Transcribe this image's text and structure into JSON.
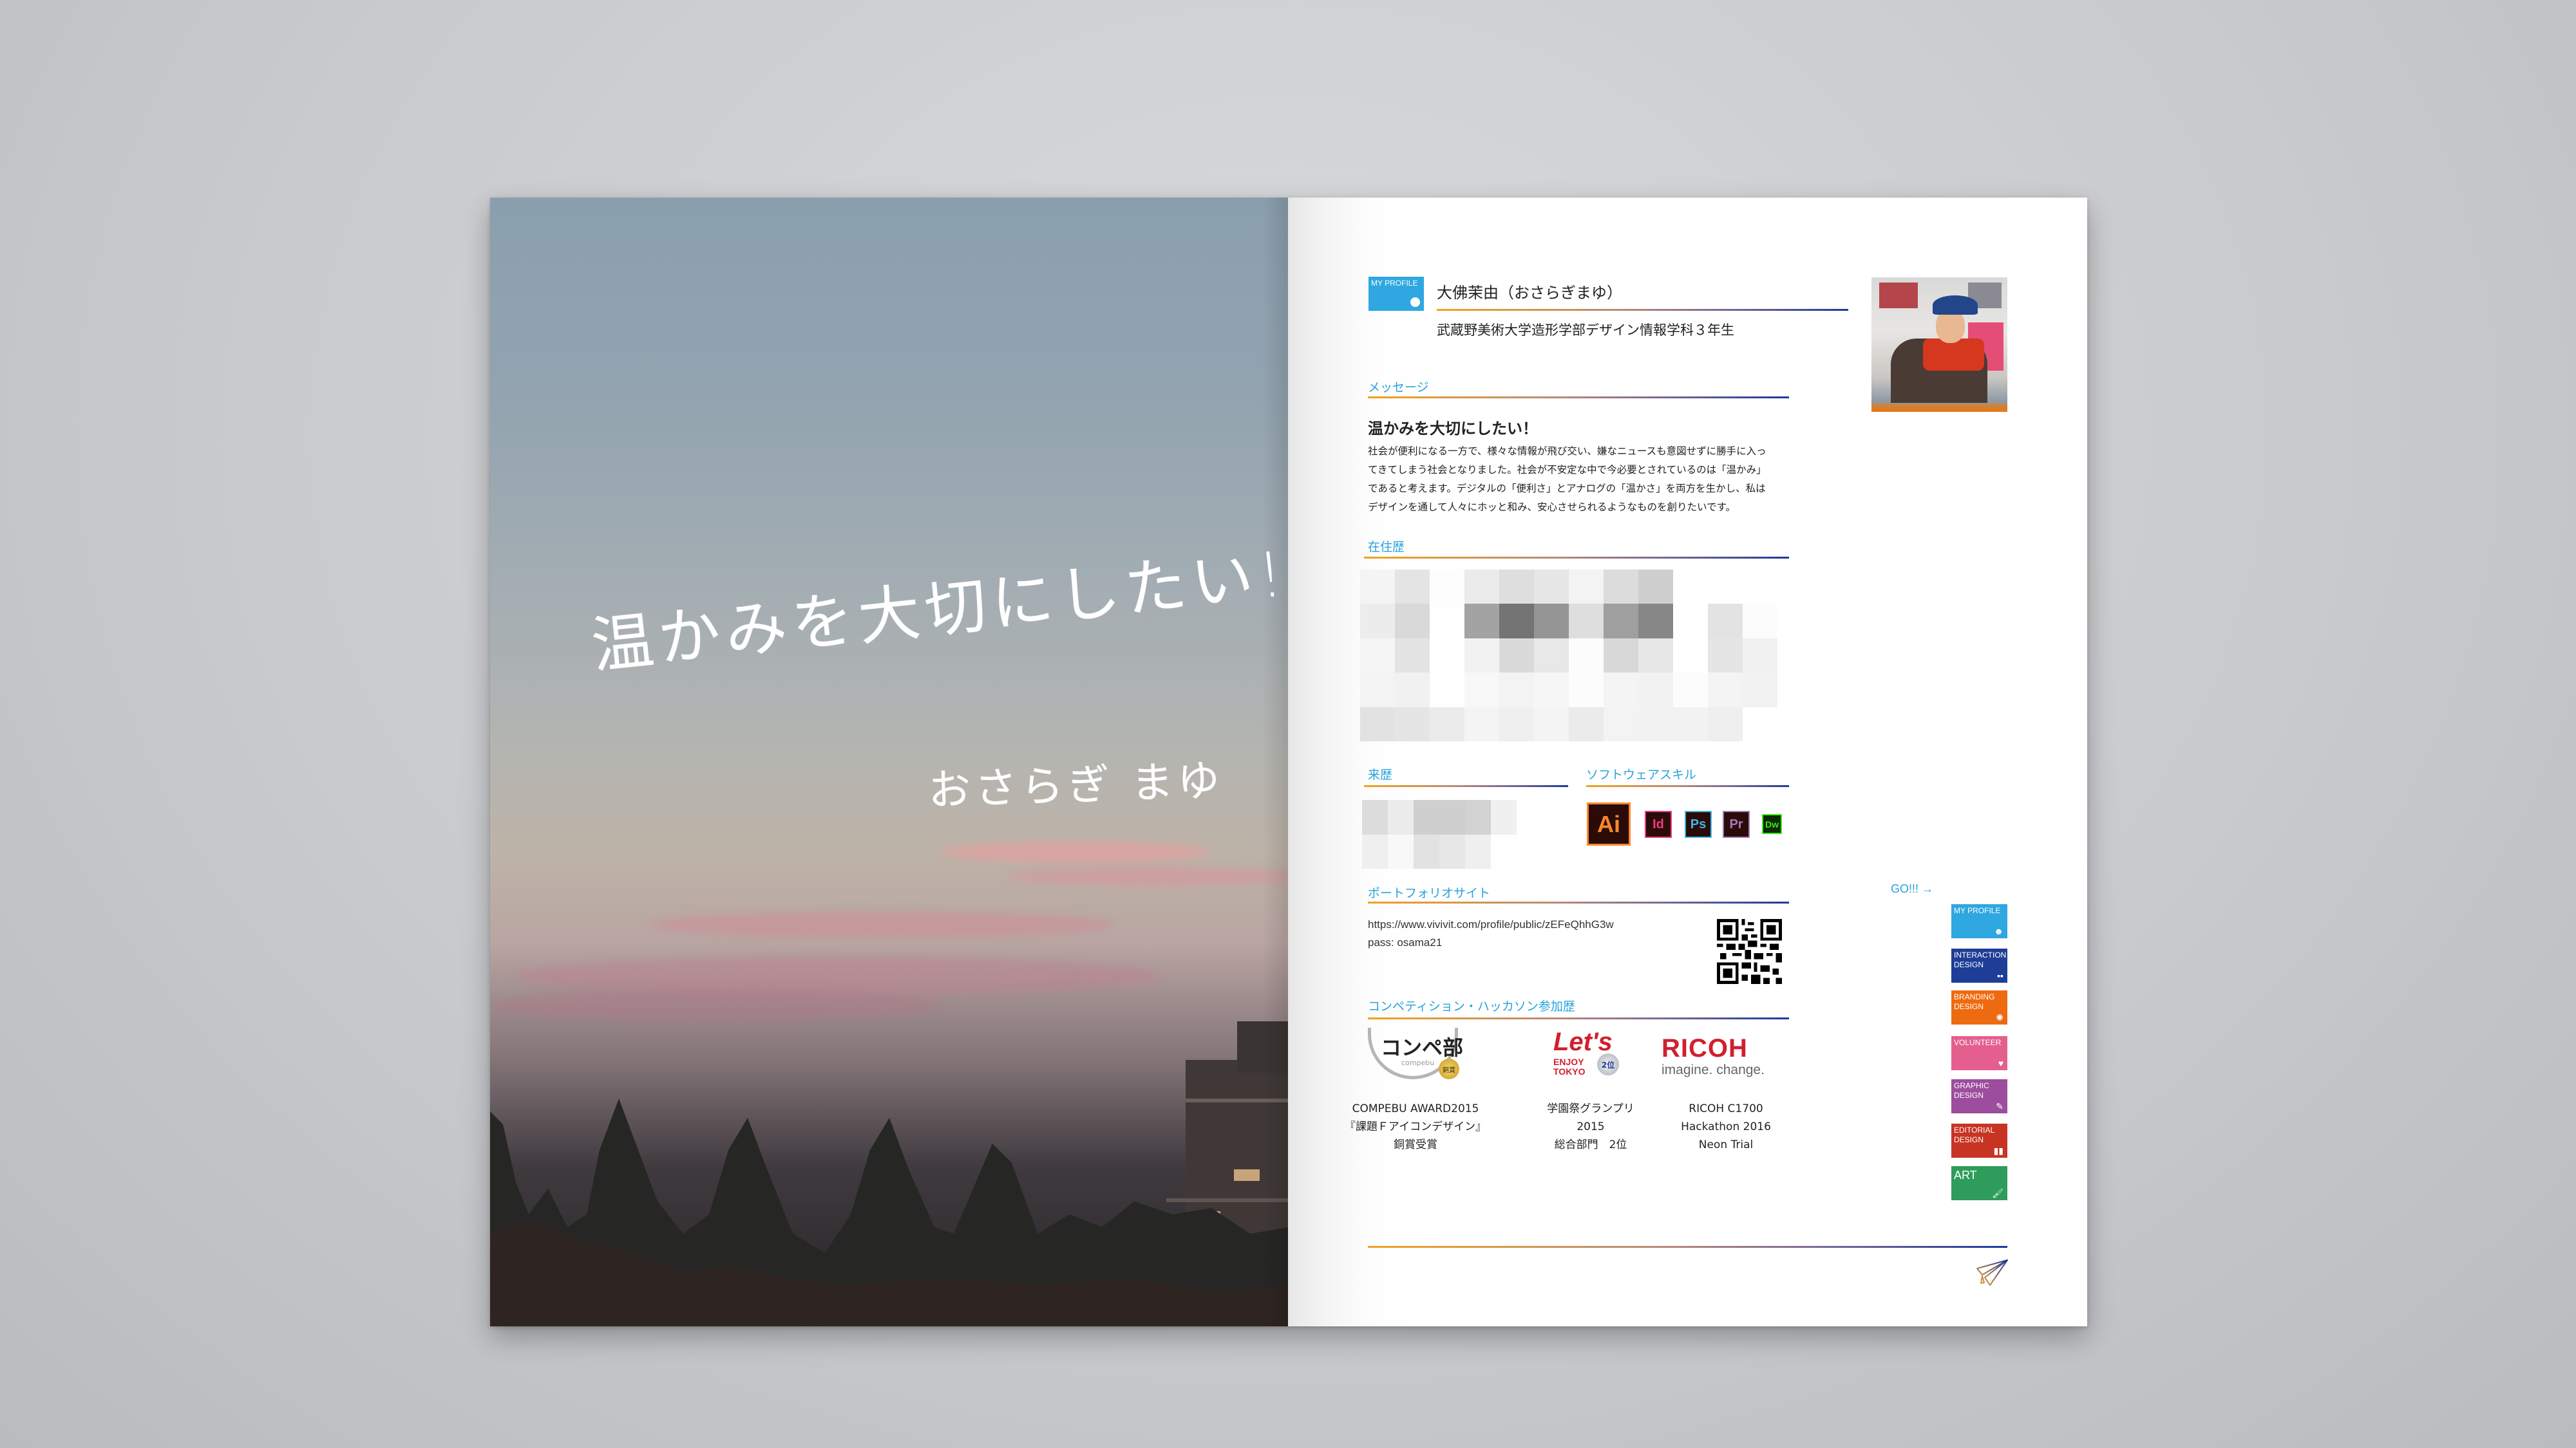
{
  "left_page": {
    "handwritten_title": "温かみを大切にしたい!",
    "handwritten_signature": "おさらぎ まゆ"
  },
  "profile": {
    "badge": {
      "label": "MY PROFILE",
      "icon": "smiley-icon",
      "color": "#2fa7e0"
    },
    "name": "大佛茉由（おさらぎまゆ）",
    "affiliation": "武蔵野美術大学造形学部デザイン情報学科３年生"
  },
  "message": {
    "section_title": "メッセージ",
    "headline": "温かみを大切にしたい！",
    "lines": [
      "社会が便利になる一方で、様々な情報が飛び交い、嫌なニュースも意図せずに勝手に入っ",
      "てきてしまう社会となりました。社会が不安定な中で今必要とされているのは「温かみ」",
      "であると考えます。デジタルの「便利さ」とアナログの「温かさ」を両方を生かし、私は",
      "デザインを通して人々にホッと和み、安心させられるようなものを創りたいです。"
    ]
  },
  "residence": {
    "section_title": "在住歴"
  },
  "history": {
    "section_title": "来歴"
  },
  "software": {
    "section_title": "ソフトウェアスキル",
    "apps": [
      {
        "abbr": "Ai",
        "name": "Illustrator",
        "color": "#f7862b"
      },
      {
        "abbr": "Id",
        "name": "InDesign",
        "color": "#ef3b7c"
      },
      {
        "abbr": "Ps",
        "name": "Photoshop",
        "color": "#3fb7e5"
      },
      {
        "abbr": "Pr",
        "name": "Premiere",
        "color": "#a47ab9"
      },
      {
        "abbr": "Dw",
        "name": "Dreamweaver",
        "color": "#3ee513"
      }
    ]
  },
  "portfolio": {
    "section_title": "ポートフォリオサイト",
    "url": "https://www.vivivit.com/profile/public/zEFeQhhG3w",
    "pass": "pass: osama21",
    "qr_icon": "qr-code-icon"
  },
  "go_link": "GO!!! →",
  "nav_tiles": [
    {
      "line1": "MY PROFILE",
      "line2": "",
      "icon": "☻",
      "icon_name": "smiley-icon",
      "color": "#2fa7e0"
    },
    {
      "line1": "INTERACTION",
      "line2": "DESIGN",
      "icon": "▪▪",
      "icon_name": "people-icon",
      "color": "#1e3d96"
    },
    {
      "line1": "BRANDING",
      "line2": "DESIGN",
      "icon": "✺",
      "icon_name": "network-icon",
      "color": "#ee6a10"
    },
    {
      "line1": "VOLUNTEER",
      "line2": "",
      "icon": "♥",
      "icon_name": "heart-icon",
      "color": "#e45f8d"
    },
    {
      "line1": "GRAPHIC",
      "line2": "DESIGN",
      "icon": "✎",
      "icon_name": "pencil-icon",
      "color": "#9d4d9d"
    },
    {
      "line1": "EDITORIAL",
      "line2": "DESIGN",
      "icon": "▮▮",
      "icon_name": "book-icon",
      "color": "#c83424"
    },
    {
      "line1": "ART",
      "line2": "",
      "icon": "🖌",
      "icon_name": "palette-icon",
      "color": "#2e9c5a"
    }
  ],
  "competitions": {
    "section_title": "コンペティション・ハッカソン参加歴",
    "items": [
      {
        "logo_text": "コンペ部",
        "logo_sub": "compebu",
        "medal": "銅賞",
        "caption": [
          "COMPEBU AWARD2015",
          "『課題Ｆアイコンデザイン』",
          "銅賞受賞"
        ]
      },
      {
        "logo_text": "Let's",
        "logo_sub": "ENJOY TOKYO",
        "medal": "2位",
        "caption": [
          "学園祭グランプリ",
          "2015",
          "総合部門　2位"
        ]
      },
      {
        "logo_text": "RICOH",
        "logo_sub": "imagine. change.",
        "medal": "",
        "caption": [
          "RICOH C1700",
          "Hackathon 2016",
          "Neon Trial"
        ]
      }
    ]
  },
  "footer": {
    "icon": "paper-plane-icon"
  }
}
